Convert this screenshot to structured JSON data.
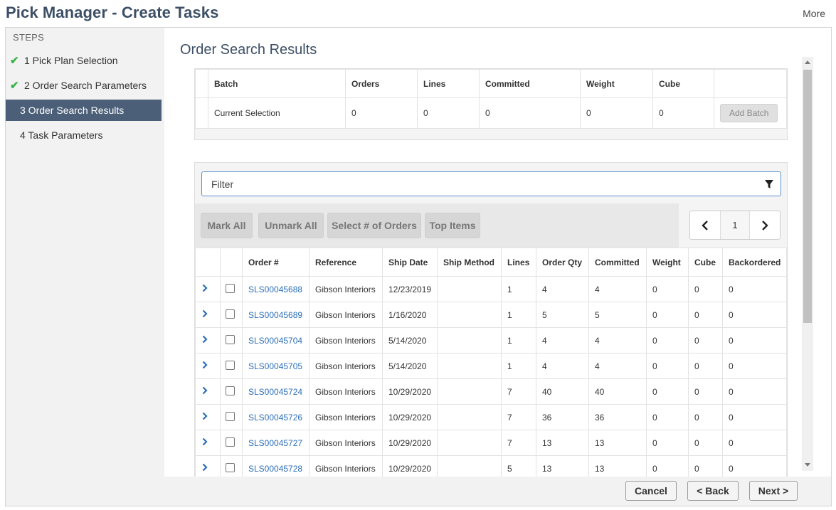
{
  "header": {
    "title": "Pick Manager - Create Tasks",
    "more_label": "More"
  },
  "sidebar": {
    "steps_label": "STEPS",
    "items": [
      {
        "label": "1 Pick Plan Selection",
        "completed": true
      },
      {
        "label": "2 Order Search Parameters",
        "completed": true
      },
      {
        "label": "3 Order Search Results",
        "active": true
      },
      {
        "label": "4 Task Parameters"
      }
    ]
  },
  "main": {
    "title": "Order Search Results",
    "batch": {
      "headers": [
        "Batch",
        "Orders",
        "Lines",
        "Committed",
        "Weight",
        "Cube"
      ],
      "row": {
        "batch": "Current Selection",
        "orders": "0",
        "lines": "0",
        "committed": "0",
        "weight": "0",
        "cube": "0"
      },
      "add_batch_label": "Add Batch"
    },
    "filter": {
      "placeholder": "Filter"
    },
    "toolbar": {
      "mark_all": "Mark All",
      "unmark_all": "Unmark All",
      "select_orders": "Select # of Orders",
      "top_items": "Top Items"
    },
    "pager": {
      "page": "1"
    },
    "orders": {
      "headers": [
        "Order #",
        "Reference",
        "Ship Date",
        "Ship Method",
        "Lines",
        "Order Qty",
        "Committed",
        "Weight",
        "Cube",
        "Backordered"
      ],
      "rows": [
        {
          "order": "SLS00045688",
          "reference": "Gibson Interiors",
          "ship_date": "12/23/2019",
          "ship_method": "",
          "lines": "1",
          "order_qty": "4",
          "committed": "4",
          "weight": "0",
          "cube": "0",
          "backordered": "0"
        },
        {
          "order": "SLS00045689",
          "reference": "Gibson Interiors",
          "ship_date": "1/16/2020",
          "ship_method": "",
          "lines": "1",
          "order_qty": "5",
          "committed": "5",
          "weight": "0",
          "cube": "0",
          "backordered": "0"
        },
        {
          "order": "SLS00045704",
          "reference": "Gibson Interiors",
          "ship_date": "5/14/2020",
          "ship_method": "",
          "lines": "1",
          "order_qty": "4",
          "committed": "4",
          "weight": "0",
          "cube": "0",
          "backordered": "0"
        },
        {
          "order": "SLS00045705",
          "reference": "Gibson Interiors",
          "ship_date": "5/14/2020",
          "ship_method": "",
          "lines": "1",
          "order_qty": "4",
          "committed": "4",
          "weight": "0",
          "cube": "0",
          "backordered": "0"
        },
        {
          "order": "SLS00045724",
          "reference": "Gibson Interiors",
          "ship_date": "10/29/2020",
          "ship_method": "",
          "lines": "7",
          "order_qty": "40",
          "committed": "40",
          "weight": "0",
          "cube": "0",
          "backordered": "0"
        },
        {
          "order": "SLS00045726",
          "reference": "Gibson Interiors",
          "ship_date": "10/29/2020",
          "ship_method": "",
          "lines": "7",
          "order_qty": "36",
          "committed": "36",
          "weight": "0",
          "cube": "0",
          "backordered": "0"
        },
        {
          "order": "SLS00045727",
          "reference": "Gibson Interiors",
          "ship_date": "10/29/2020",
          "ship_method": "",
          "lines": "7",
          "order_qty": "13",
          "committed": "13",
          "weight": "0",
          "cube": "0",
          "backordered": "0"
        },
        {
          "order": "SLS00045728",
          "reference": "Gibson Interiors",
          "ship_date": "10/29/2020",
          "ship_method": "",
          "lines": "5",
          "order_qty": "13",
          "committed": "13",
          "weight": "0",
          "cube": "0",
          "backordered": "0"
        }
      ]
    }
  },
  "footer": {
    "cancel_label": "Cancel",
    "back_label": "< Back",
    "next_label": "Next >"
  },
  "colors": {
    "accent": "#4c5f78",
    "title": "#3c4f66",
    "link": "#2c6fb8",
    "check": "#3cb449"
  },
  "icons": {
    "step_done": "check-icon",
    "filter": "funnel-icon",
    "expand": "chevron-right-icon"
  }
}
